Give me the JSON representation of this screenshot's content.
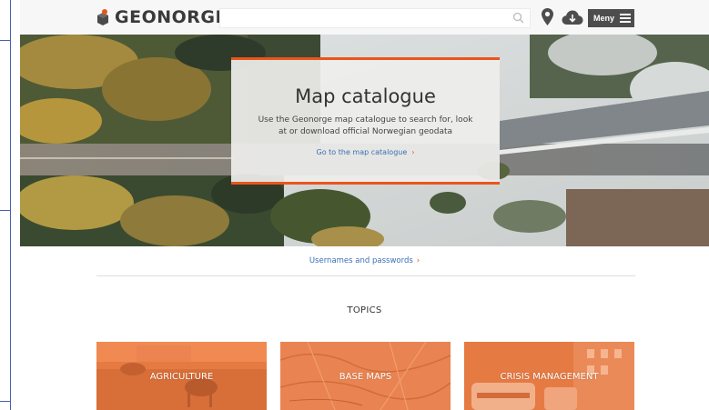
{
  "header": {
    "logo_text": "GEONORGE",
    "search_placeholder": "",
    "menu_label": "Meny",
    "accent_color": "#e8561c"
  },
  "hero": {
    "title": "Map catalogue",
    "description": "Use the Geonorge map catalogue to search for, look at or download official Norwegian geodata",
    "link_label": "Go to the map catalogue",
    "link_chevron": "›"
  },
  "main": {
    "credentials_link": "Usernames and passwords",
    "credentials_chevron": "›",
    "topics_heading": "TOPICS",
    "topics": [
      {
        "label": "AGRICULTURE"
      },
      {
        "label": "BASE MAPS"
      },
      {
        "label": "CRISIS MANAGEMENT"
      }
    ]
  },
  "icons": [
    "logo-icon",
    "search-icon",
    "map-pin-icon",
    "cloud-download-icon",
    "hamburger-menu-icon"
  ]
}
